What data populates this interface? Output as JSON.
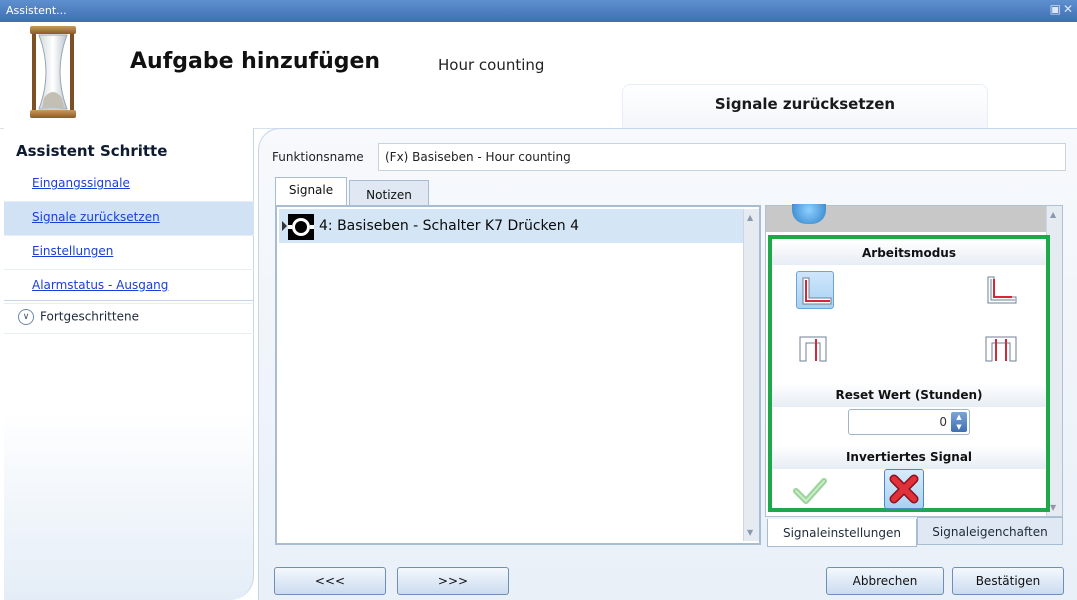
{
  "window": {
    "title": "Assistent...",
    "controls": [
      "restore-icon",
      "close-icon"
    ]
  },
  "header": {
    "title": "Aufgabe hinzufügen",
    "subtitle": "Hour counting",
    "logo_icon": "hourglass-icon",
    "current_step_tab": "Signale zurücksetzen"
  },
  "sidebar": {
    "heading": "Assistent Schritte",
    "items": [
      {
        "label": "Eingangssignale",
        "active": false
      },
      {
        "label": "Signale zurücksetzen",
        "active": true
      },
      {
        "label": "Einstellungen",
        "active": false
      },
      {
        "label": "Alarmstatus - Ausgang",
        "active": false
      }
    ],
    "advanced": {
      "label": "Fortgeschrittene",
      "icon": "chevron-down-icon"
    }
  },
  "function": {
    "label": "Funktionsname",
    "value": "(Fx) Basiseben - Hour counting"
  },
  "tabs": [
    {
      "label": "Signale",
      "selected": true
    },
    {
      "label": "Notizen",
      "selected": false
    }
  ],
  "signals": [
    {
      "label": "4: Basiseben - Schalter K7 Drücken 4",
      "icon": "button-signal-icon",
      "selected": true
    }
  ],
  "settings": {
    "mode_heading": "Arbeitsmodus",
    "modes": [
      {
        "icon": "rising-edge-mode-icon",
        "selected": true
      },
      {
        "icon": "falling-edge-mode-icon",
        "selected": false
      },
      {
        "icon": "pulse-rising-mode-icon",
        "selected": false
      },
      {
        "icon": "pulse-both-edges-mode-icon",
        "selected": false
      }
    ],
    "reset_heading": "Reset Wert (Stunden)",
    "reset_value": "0",
    "inverted_heading": "Invertiertes Signal",
    "inverted_options": [
      {
        "icon": "checkmark-icon",
        "selected": false
      },
      {
        "icon": "red-x-icon",
        "selected": true
      }
    ],
    "highlight_color": "#1fa84a"
  },
  "settings_tabs": [
    {
      "label": "Signaleinstellungen",
      "selected": true
    },
    {
      "label": "Signaleigenchaften",
      "selected": false
    }
  ],
  "nav": {
    "back_label": "<<<",
    "next_label": ">>>",
    "cancel_label": "Abbrechen",
    "confirm_label": "Bestätigen"
  }
}
